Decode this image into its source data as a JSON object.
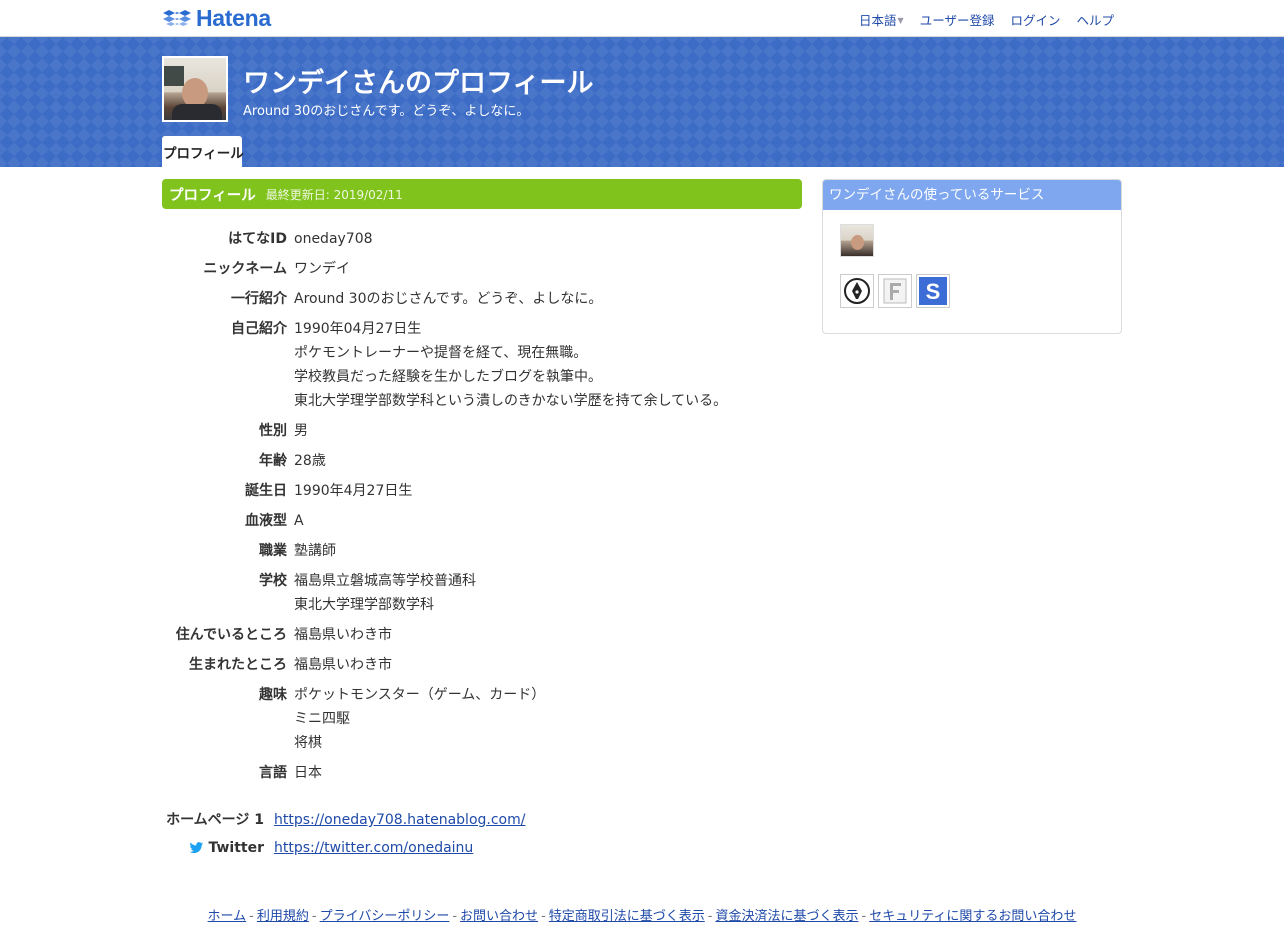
{
  "topbar": {
    "logo_text": "Hatena",
    "nav": {
      "language": "日本語",
      "register": "ユーザー登録",
      "login": "ログイン",
      "help": "ヘルプ"
    }
  },
  "header": {
    "title": "ワンデイさんのプロフィール",
    "description": "Around 30のおじさんです。どうぞ、よしなに。",
    "tab": "プロフィール"
  },
  "profile": {
    "section_title": "プロフィール",
    "updated": "最終更新日: 2019/02/11",
    "rows": [
      {
        "label": "はてなID",
        "values": [
          "oneday708"
        ]
      },
      {
        "label": "ニックネーム",
        "values": [
          "ワンデイ"
        ]
      },
      {
        "label": "一行紹介",
        "values": [
          "Around 30のおじさんです。どうぞ、よしなに。"
        ]
      },
      {
        "label": "自己紹介",
        "values": [
          "1990年04月27日生",
          "ポケモントレーナーや提督を経て、現在無職。",
          "学校教員だった経験を生かしたブログを執筆中。",
          "東北大学理学部数学科という潰しのきかない学歴を持て余している。"
        ]
      },
      {
        "label": "性別",
        "values": [
          "男"
        ]
      },
      {
        "label": "年齢",
        "values": [
          "28歳"
        ]
      },
      {
        "label": "誕生日",
        "values": [
          "1990年4月27日生"
        ]
      },
      {
        "label": "血液型",
        "values": [
          "A"
        ]
      },
      {
        "label": "職業",
        "values": [
          "塾講師"
        ]
      },
      {
        "label": "学校",
        "values": [
          "福島県立磐城高等学校普通科",
          "東北大学理学部数学科"
        ]
      },
      {
        "label": "住んでいるところ",
        "values": [
          "福島県いわき市"
        ]
      },
      {
        "label": "生まれたところ",
        "values": [
          "福島県いわき市"
        ]
      },
      {
        "label": "趣味",
        "values": [
          "ポケットモンスター（ゲーム、カード）",
          "ミニ四駆",
          "将棋"
        ]
      },
      {
        "label": "言語",
        "values": [
          "日本"
        ]
      }
    ],
    "homepage_label": "ホームページ 1",
    "homepage_url": "https://oneday708.hatenablog.com/",
    "twitter_label": "Twitter",
    "twitter_url": "https://twitter.com/onedainu"
  },
  "sidebar": {
    "title": "ワンデイさんの使っているサービス",
    "services": [
      "blog-pen-icon",
      "fotolife-f-icon",
      "star-s-icon"
    ]
  },
  "footer": {
    "links": [
      "ホーム",
      "利用規約",
      "プライバシーポリシー",
      "お問い合わせ",
      "特定商取引法に基づく表示",
      "資金決済法に基づく表示",
      "セキュリティに関するお問い合わせ"
    ]
  },
  "colors": {
    "banner": "#3c6cc6",
    "section_head": "#7fc31c",
    "sidebar_head": "#7ea7f0",
    "link": "#1f4aa8"
  }
}
